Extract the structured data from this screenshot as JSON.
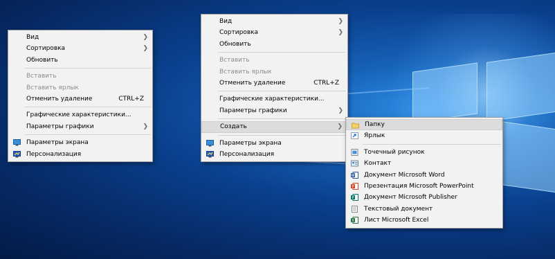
{
  "menu1": {
    "items": [
      {
        "label": "Вид",
        "arrow": true
      },
      {
        "label": "Сортировка",
        "arrow": true
      },
      {
        "label": "Обновить"
      },
      {
        "label": "Вставить",
        "disabled": true
      },
      {
        "label": "Вставить ярлык",
        "disabled": true
      },
      {
        "label": "Отменить удаление",
        "shortcut": "CTRL+Z"
      },
      {
        "label": "Графические характеристики..."
      },
      {
        "label": "Параметры графики",
        "arrow": true
      },
      {
        "label": "Параметры экрана",
        "icon": "display-settings-icon"
      },
      {
        "label": "Персонализация",
        "icon": "personalize-icon"
      }
    ]
  },
  "menu2": {
    "items": [
      {
        "label": "Вид",
        "arrow": true
      },
      {
        "label": "Сортировка",
        "arrow": true
      },
      {
        "label": "Обновить"
      },
      {
        "label": "Вставить",
        "disabled": true
      },
      {
        "label": "Вставить ярлык",
        "disabled": true
      },
      {
        "label": "Отменить удаление",
        "shortcut": "CTRL+Z"
      },
      {
        "label": "Графические характеристики..."
      },
      {
        "label": "Параметры графики",
        "arrow": true
      },
      {
        "label": "Создать",
        "arrow": true,
        "highlighted": true
      },
      {
        "label": "Параметры экрана",
        "icon": "display-settings-icon"
      },
      {
        "label": "Персонализация",
        "icon": "personalize-icon"
      }
    ]
  },
  "submenu": {
    "items": [
      {
        "label": "Папку",
        "icon": "folder-icon",
        "highlighted": true
      },
      {
        "label": "Ярлык",
        "icon": "shortcut-icon"
      },
      {
        "label": "Точечный рисунок",
        "icon": "bitmap-icon"
      },
      {
        "label": "Контакт",
        "icon": "contact-icon"
      },
      {
        "label": "Документ Microsoft Word",
        "icon": "word-icon"
      },
      {
        "label": "Презентация Microsoft PowerPoint",
        "icon": "powerpoint-icon"
      },
      {
        "label": "Документ Microsoft Publisher",
        "icon": "publisher-icon"
      },
      {
        "label": "Текстовый документ",
        "icon": "text-document-icon"
      },
      {
        "label": "Лист Microsoft Excel",
        "icon": "excel-icon"
      }
    ]
  },
  "colors": {
    "menu_bg": "#f2f2f2",
    "highlight": "#dcdcdc",
    "disabled_text": "#8d8d8d",
    "word": "#2b579a",
    "powerpoint": "#d24726",
    "publisher": "#077568",
    "excel": "#217346",
    "folder": "#f5d36b"
  }
}
